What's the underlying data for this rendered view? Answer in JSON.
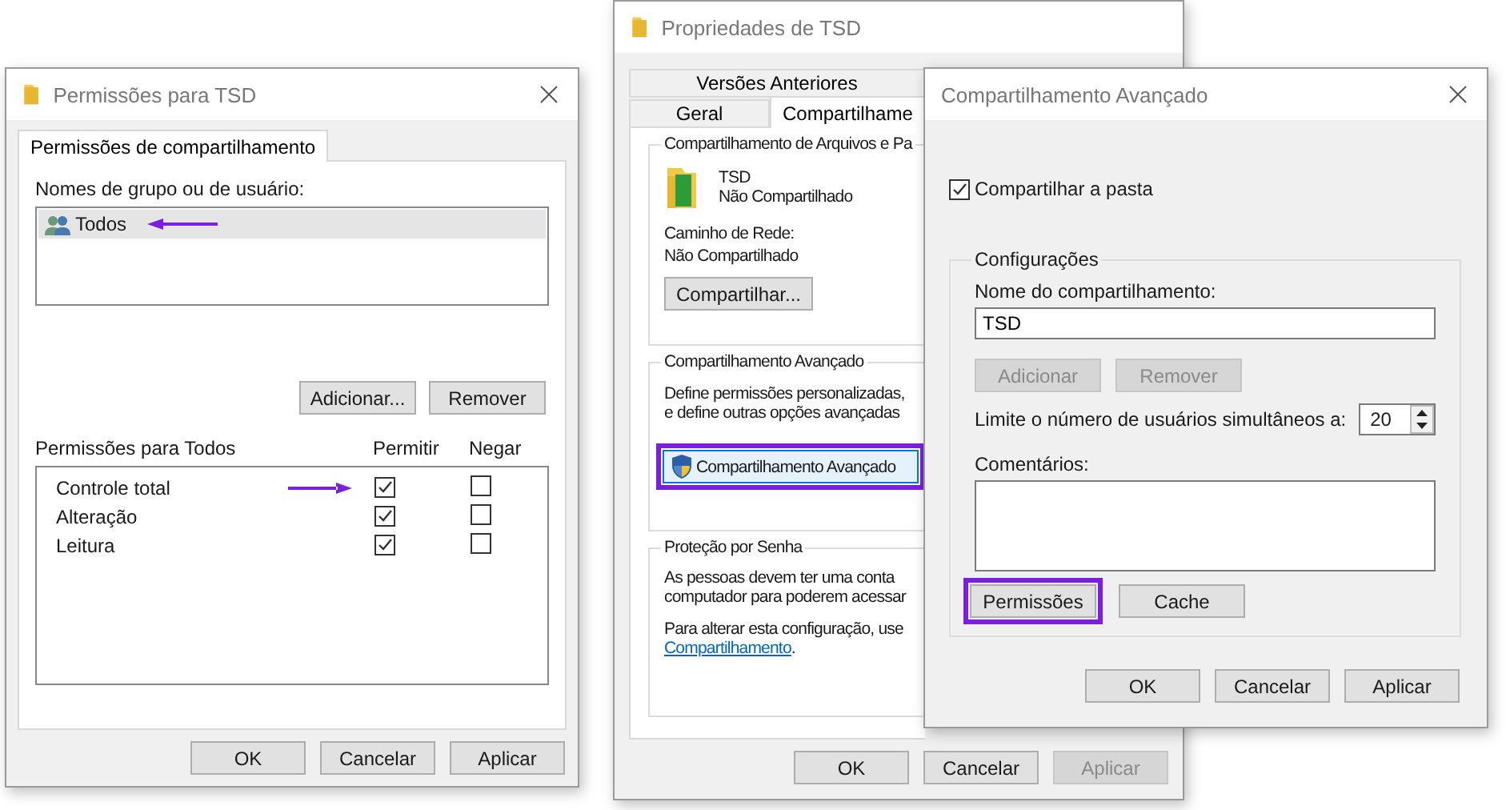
{
  "permissions_dialog": {
    "title": "Permissões para TSD",
    "tabs": [
      {
        "label": "Permissões de compartilhamento",
        "selected": true
      }
    ],
    "users_label": "Nomes de grupo ou de usuário:",
    "users": [
      {
        "name": "Todos",
        "selected": true,
        "pointed": true
      }
    ],
    "user_buttons": [
      {
        "label": "Adicionar...",
        "disabled": false
      },
      {
        "label": "Remover",
        "disabled": false
      }
    ],
    "permissions_label": "Permissões para Todos",
    "columns": [
      "Permitir",
      "Negar"
    ],
    "permissions": [
      {
        "name": "Controle total",
        "allow": true,
        "deny": false,
        "pointed": true
      },
      {
        "name": "Alteração",
        "allow": true,
        "deny": false,
        "pointed": false
      },
      {
        "name": "Leitura",
        "allow": true,
        "deny": false,
        "pointed": false
      }
    ],
    "buttons": [
      {
        "label": "OK",
        "disabled": false
      },
      {
        "label": "Cancelar",
        "disabled": false
      },
      {
        "label": "Aplicar",
        "disabled": false
      }
    ]
  },
  "properties_dialog": {
    "title": "Propriedades de TSD",
    "tab_rows": [
      [
        {
          "label": "Versões Anteriores",
          "selected": false
        }
      ],
      [
        {
          "label": "Geral",
          "selected": false
        },
        {
          "label": "Compartilhame",
          "selected": true
        }
      ]
    ],
    "file_sharing": {
      "heading": "Compartilhamento de Arquivos e Pa",
      "name": "TSD",
      "status": "Não Compartilhado",
      "path_label": "Caminho de Rede:",
      "path": "Não Compartilhado",
      "button": "Compartilhar..."
    },
    "advanced_sharing": {
      "heading": "Compartilhamento Avançado",
      "lines": [
        "Define permissões personalizadas,",
        "e define outras opções avançadas"
      ],
      "button": {
        "label": "Compartilhamento Avançado",
        "highlighted": true
      }
    },
    "password": {
      "heading": "Proteção por Senha",
      "lines": [
        "As pessoas devem ter uma conta",
        "computador para poderem acessar"
      ],
      "note": "Para alterar esta configuração, use",
      "link": "Compartilhamento",
      "after_link": "."
    },
    "buttons": [
      {
        "label": "OK",
        "disabled": false
      },
      {
        "label": "Cancelar",
        "disabled": false
      },
      {
        "label": "Aplicar",
        "disabled": true
      }
    ]
  },
  "advanced_dialog": {
    "title": "Compartilhamento Avançado",
    "share_folder": {
      "label": "Compartilhar a pasta",
      "checked": true
    },
    "group_title": "Configurações",
    "share_name_label": "Nome do compartilhamento:",
    "share_name": "TSD",
    "name_buttons": [
      {
        "label": "Adicionar",
        "disabled": true
      },
      {
        "label": "Remover",
        "disabled": true
      }
    ],
    "limit_label": "Limite o número de usuários simultâneos a:",
    "limit": "20",
    "comments_label": "Comentários:",
    "group_buttons": [
      {
        "label": "Permissões",
        "highlighted": true
      },
      {
        "label": "Cache",
        "highlighted": false
      }
    ],
    "buttons": [
      {
        "label": "OK",
        "disabled": false
      },
      {
        "label": "Cancelar",
        "disabled": false
      },
      {
        "label": "Aplicar",
        "disabled": false
      }
    ]
  }
}
